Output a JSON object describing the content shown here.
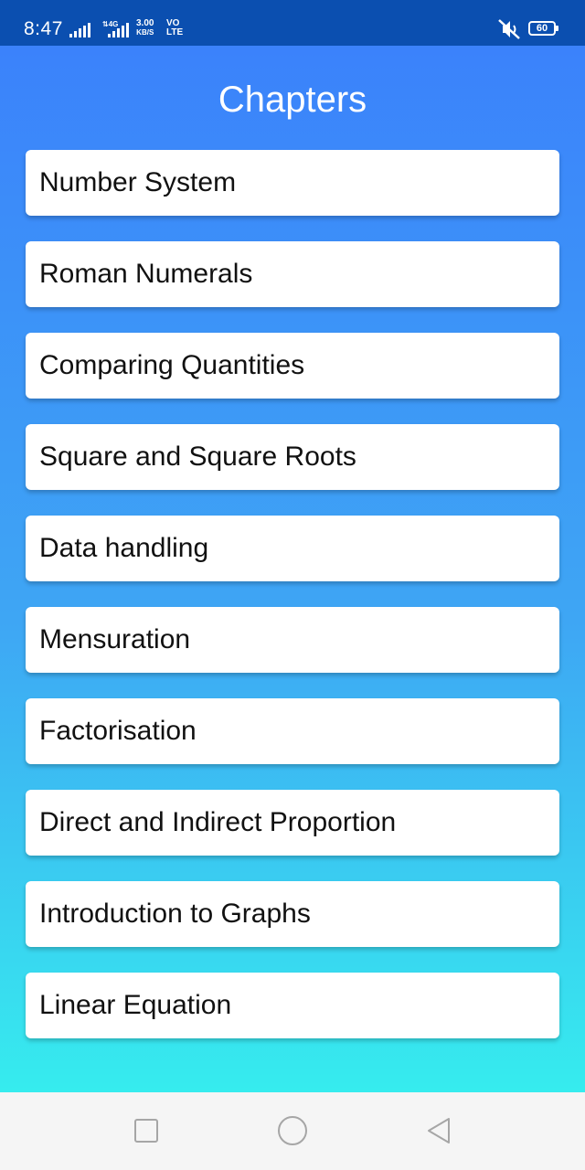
{
  "status_bar": {
    "time": "8:47",
    "network_tag": "4G",
    "speed_value": "3.00",
    "speed_unit": "KB/S",
    "volte_top": "VO",
    "volte_bottom": "LTE",
    "battery": "60",
    "icons": [
      "signal-bars-icon",
      "signal-bars-icon",
      "mute-icon",
      "battery-icon"
    ]
  },
  "header": {
    "title": "Chapters"
  },
  "chapters": [
    {
      "label": "Number System"
    },
    {
      "label": "Roman Numerals"
    },
    {
      "label": "Comparing Quantities"
    },
    {
      "label": "Square and Square Roots"
    },
    {
      "label": "Data handling"
    },
    {
      "label": "Mensuration"
    },
    {
      "label": "Factorisation"
    },
    {
      "label": "Direct and Indirect Proportion"
    },
    {
      "label": "Introduction to Graphs"
    },
    {
      "label": "Linear Equation"
    }
  ],
  "nav_bar": {
    "icons": [
      "recent-apps-icon",
      "home-icon",
      "back-icon"
    ]
  },
  "colors": {
    "status_bar": "#0b4fb0",
    "gradient_top": "#3b82fb",
    "gradient_bottom": "#36ecee",
    "card": "#ffffff",
    "text": "#111111"
  }
}
